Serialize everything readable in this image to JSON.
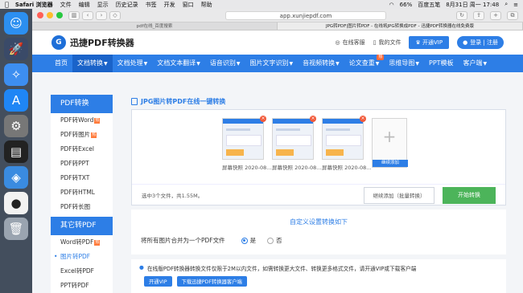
{
  "menubar": {
    "app": "Safari 浏览器",
    "items": [
      "文件",
      "编辑",
      "显示",
      "历史记录",
      "书签",
      "开发",
      "窗口",
      "帮助"
    ],
    "battery": "66%",
    "ime": "百度五笔",
    "clock": "8月31日 周一  17:48"
  },
  "browser": {
    "url": "app.xunjiepdf.com",
    "tabs": [
      "pdf在线_百度搜索",
      "JPG转PDF|图片转PDF - 在线将JPG转换成PDF - 迅捷PDF转换器在线免费版"
    ]
  },
  "header": {
    "logo_letter": "G",
    "logo_text": "迅捷PDF转换器",
    "service": "在线客服",
    "myfiles": "我的文件",
    "vip": "开通VIP",
    "login": "登录 | 注册"
  },
  "nav": [
    {
      "label": "首页",
      "caret": ""
    },
    {
      "label": "文档转换",
      "caret": "▼"
    },
    {
      "label": "文档处理",
      "caret": "▼"
    },
    {
      "label": "文档文本翻译",
      "caret": "▼"
    },
    {
      "label": "语音识别",
      "caret": "▼"
    },
    {
      "label": "图片文字识别",
      "caret": "▼"
    },
    {
      "label": "音视频转换",
      "caret": "▼"
    },
    {
      "label": "论文查重",
      "caret": "▼",
      "badge": "热"
    },
    {
      "label": "思维导图",
      "caret": "▼"
    },
    {
      "label": "PPT模板",
      "caret": ""
    },
    {
      "label": "客户端",
      "caret": "▼"
    }
  ],
  "sidebar": {
    "section1": "PDF转换",
    "items1": [
      {
        "label": "PDF转Word",
        "hot": "热"
      },
      {
        "label": "PDF转图片",
        "hot": "热"
      },
      {
        "label": "PDF转Excel",
        "hot": ""
      },
      {
        "label": "PDF转PPT",
        "hot": ""
      },
      {
        "label": "PDF转TXT",
        "hot": ""
      },
      {
        "label": "PDF转HTML",
        "hot": ""
      },
      {
        "label": "PDF转长图",
        "hot": ""
      }
    ],
    "section2": "其它转PDF",
    "items2": [
      {
        "label": "Word转PDF",
        "hot": "热"
      },
      {
        "label": "图片转PDF",
        "hot": ""
      },
      {
        "label": "Excel转PDF",
        "hot": ""
      },
      {
        "label": "PPT转PDF",
        "hot": ""
      }
    ]
  },
  "main": {
    "title": "JPG图片转PDF在线一键转换",
    "thumbs": [
      "屏幕快照 2020-08...",
      "屏幕快照 2020-08...",
      "屏幕快照 2020-08..."
    ],
    "add_label": "继续添加",
    "selected": "选中3个文件，共1.55M。",
    "continue_btn": "继续添加（批量转换）",
    "start_btn": "开始转换",
    "settings_title": "自定义设置转换如下",
    "merge_label": "将所有图片合并为一个PDF文件",
    "yes": "是",
    "no": "否",
    "notice": "在线版PDF转换器转换文件仅限于2M以内文件，如需转换更大文件、转换更多格式文件，请开通VIP或下载客户端",
    "notice_vip": "开通VIP",
    "notice_download": "下载迅捷PDF转换器客户端"
  }
}
